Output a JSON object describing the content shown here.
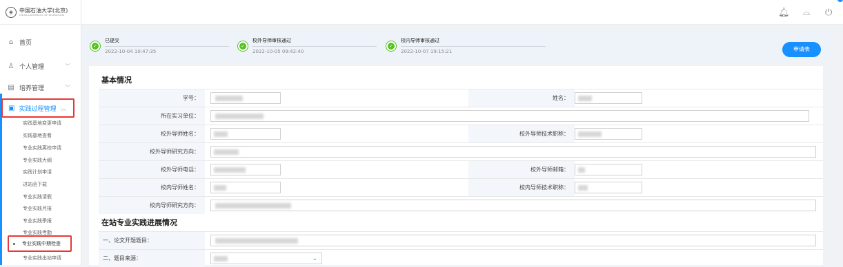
{
  "logo": {
    "text": "中国石油大学(北京)",
    "sub": "CHINA UNIVERSITY OF PETROLEUM"
  },
  "sidebar": {
    "items": [
      {
        "label": "首页",
        "icon": "home-icon"
      },
      {
        "label": "个人管理",
        "icon": "user-icon"
      },
      {
        "label": "培养管理",
        "icon": "chart-icon"
      },
      {
        "label": "实践过程管理",
        "icon": "briefcase-icon"
      }
    ],
    "subitems": [
      "实践基地变更申请",
      "实践基地查看",
      "专业实践离校申请",
      "专业实践大纲",
      "实践计划申请",
      "进站函下载",
      "专业实践请假",
      "专业实践月报",
      "专业实践季报",
      "专业实践考勤"
    ],
    "active_sub": "专业实践中期检查",
    "last_sub": "专业实践出站申请"
  },
  "topbar": {
    "icons": [
      "bell-icon",
      "lock-icon",
      "power-icon"
    ]
  },
  "steps": [
    {
      "title": "已提交",
      "date": "2022-10-04 10:47:35"
    },
    {
      "title": "校外导师审核通过",
      "date": "2022-10-05 09:42:40"
    },
    {
      "title": "校内导师审核通过",
      "date": "2022-10-07 19:15:21"
    }
  ],
  "apply_button": "申请表",
  "section1_title": "基本情况",
  "section2_title": "在站专业实践进展情况",
  "fields": {
    "student_id": "学号：",
    "name": "姓名：",
    "unit": "所在实习单位：",
    "ext_tutor_name": "校外导师姓名：",
    "ext_tutor_title": "校外导师技术职称：",
    "ext_tutor_research": "校外导师研究方向：",
    "ext_tutor_phone": "校外导师电话：",
    "ext_tutor_email": "校外导师邮箱：",
    "int_tutor_name": "校内导师姓名：",
    "int_tutor_title": "校内导师技术职称：",
    "int_tutor_research": "校内导师研究方向：",
    "thesis_topic": "一、论文开题题目：",
    "topic_source": "二、题目来源："
  },
  "colors": {
    "accent": "#1890ff",
    "success": "#52c41a",
    "highlight": "#e53935"
  }
}
